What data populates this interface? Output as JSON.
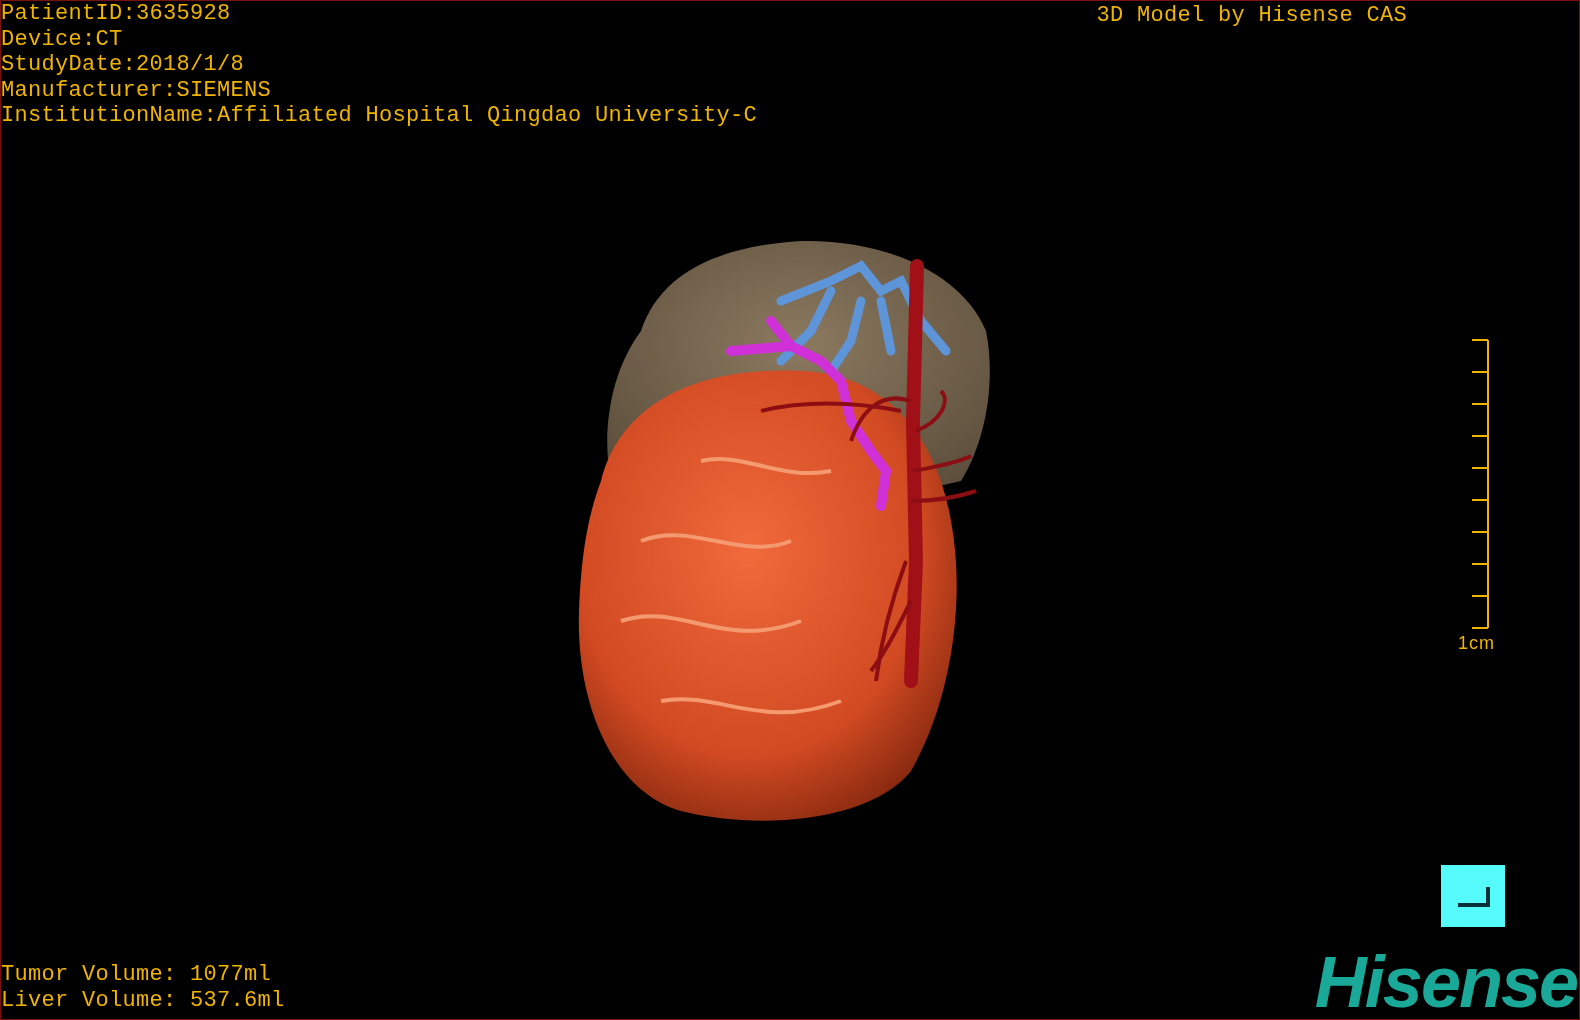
{
  "study_info": [
    "PatientID:3635928",
    "Device:CT",
    "StudyDate:2018/1/8",
    "Manufacturer:SIEMENS",
    "InstitutionName:Affiliated Hospital Qingdao University-C"
  ],
  "title": "3D Model by Hisense CAS",
  "scale_bar": {
    "label": "1cm"
  },
  "volumes": [
    "Tumor Volume: 1077ml",
    "Liver Volume: 537.6ml"
  ],
  "logo": "Hisense"
}
